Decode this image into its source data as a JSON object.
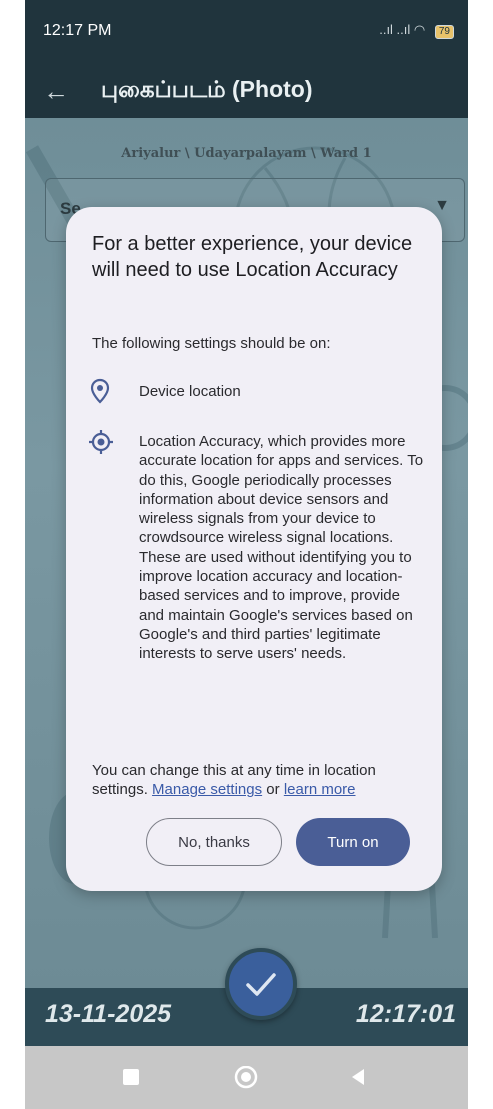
{
  "status": {
    "time": "12:17 PM",
    "signal": "..ıl ..ıl",
    "battery": "79"
  },
  "app_bar": {
    "title": "புகைப்படம் (Photo)"
  },
  "breadcrumb": "Ariyalur \\ Udayarpalayam \\ Ward 1",
  "select": {
    "label": "Se"
  },
  "dialog": {
    "title": "For a better experience, your device will need to use Location Accuracy",
    "subtitle": "The following settings should be on:",
    "items": [
      {
        "label": "Device location"
      },
      {
        "label": "Location Accuracy, which provides more accurate location for apps and services. To do this, Google periodically processes information about device sensors and wireless signals from your device to crowdsource wireless signal locations. These are used without identifying you to improve location accuracy and location-based services and to improve, provide and maintain Google's services based on Google's and third parties' legitimate interests to serve users' needs."
      }
    ],
    "footer_prefix": "You can change this at any time in location settings.",
    "manage_link": "Manage settings",
    "or_text": "or",
    "learn_link": "learn more",
    "no_button": "No, thanks",
    "on_button": "Turn on"
  },
  "bottom": {
    "date": "13-11-2025",
    "time": "12:17:01"
  },
  "colors": {
    "accent": "#4a5e96",
    "app_bar": "#20343d",
    "panel": "#2e4b57"
  }
}
